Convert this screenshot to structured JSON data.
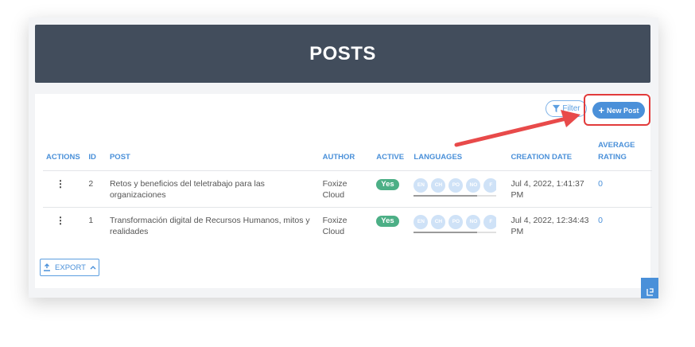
{
  "header": {
    "title": "POSTS"
  },
  "toolbar": {
    "filter_label": "Filter",
    "new_post_label": "New Post",
    "export_label": "EXPORT"
  },
  "table": {
    "columns": [
      "ACTIONS",
      "ID",
      "POST",
      "AUTHOR",
      "ACTIVE",
      "LANGUAGES",
      "CREATION DATE",
      "AVERAGE RATING"
    ],
    "language_chips": [
      "EN",
      "CH",
      "PO",
      "NO",
      "F"
    ],
    "rows": [
      {
        "id": "2",
        "post": "Retos y beneficios del teletrabajo para las organizaciones",
        "author": "Foxize Cloud",
        "active": "Yes",
        "created": "Jul 4, 2022, 1:41:37 PM",
        "rating": "0"
      },
      {
        "id": "1",
        "post": "Transformación digital de Recursos Humanos, mitos y realidades",
        "author": "Foxize Cloud",
        "active": "Yes",
        "created": "Jul 4, 2022, 12:34:43 PM",
        "rating": "0"
      }
    ]
  },
  "colors": {
    "header_bg": "#424d5c",
    "accent": "#4a90d9",
    "active_badge": "#4caf86",
    "highlight": "#e23b3b"
  }
}
